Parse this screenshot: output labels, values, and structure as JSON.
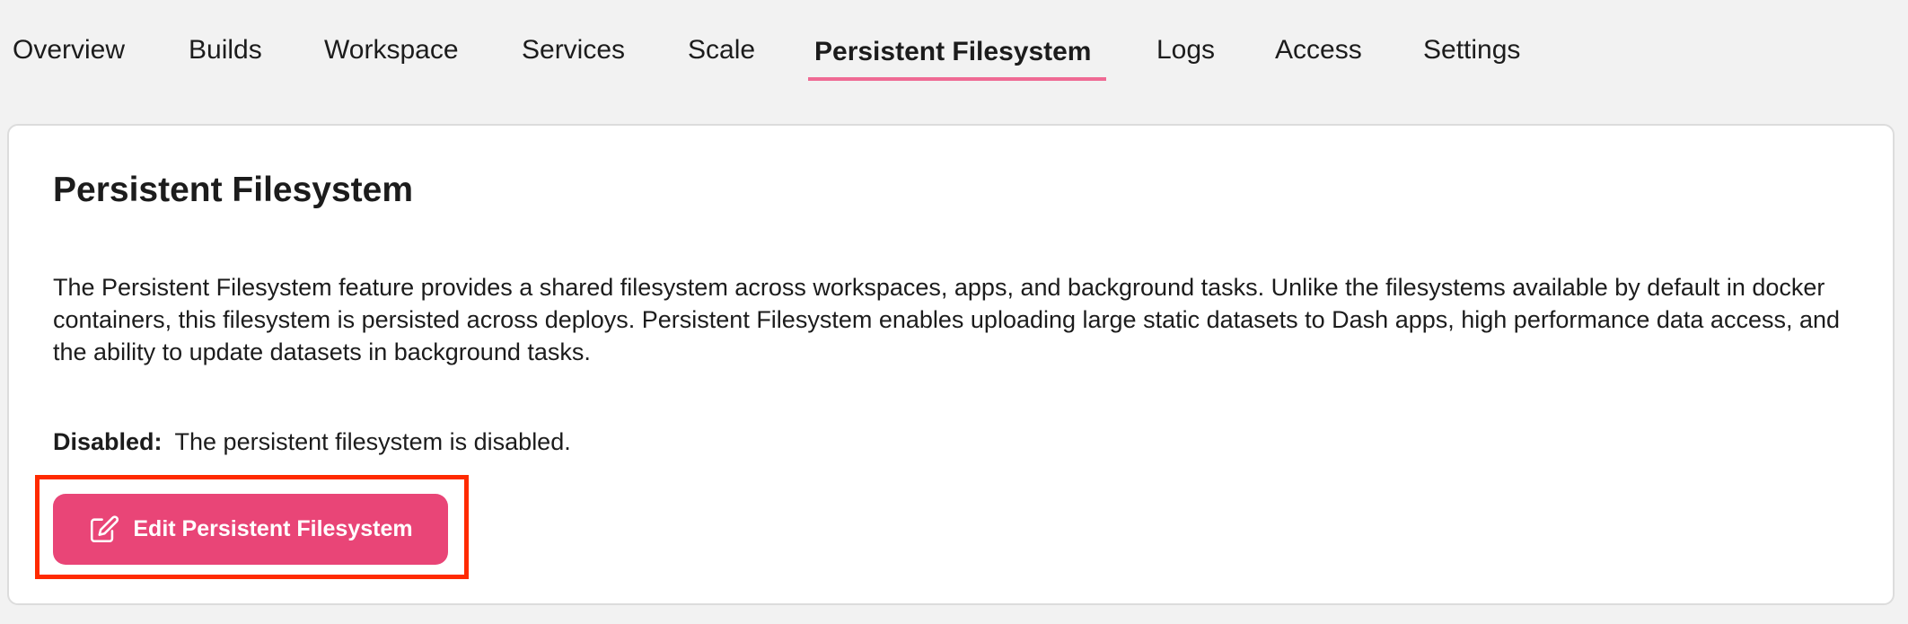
{
  "tabs": [
    {
      "label": "Overview",
      "active": false
    },
    {
      "label": "Builds",
      "active": false
    },
    {
      "label": "Workspace",
      "active": false
    },
    {
      "label": "Services",
      "active": false
    },
    {
      "label": "Scale",
      "active": false
    },
    {
      "label": "Persistent Filesystem",
      "active": true
    },
    {
      "label": "Logs",
      "active": false
    },
    {
      "label": "Access",
      "active": false
    },
    {
      "label": "Settings",
      "active": false
    }
  ],
  "card": {
    "title": "Persistent Filesystem",
    "description": "The Persistent Filesystem feature provides a shared filesystem across workspaces, apps, and background tasks. Unlike the filesystems available by default in docker containers, this filesystem is persisted across deploys. Persistent Filesystem enables uploading large static datasets to Dash apps, high performance data access, and the ability to update datasets in background tasks.",
    "status": {
      "label": "Disabled:",
      "text": "The persistent filesystem is disabled."
    },
    "edit_button": {
      "label": "Edit Persistent Filesystem",
      "icon": "edit-icon"
    }
  },
  "colors": {
    "accent": "#e94577",
    "tab_underline": "#ef6a94",
    "highlight": "#ff2a00",
    "background": "#f2f2f2"
  }
}
